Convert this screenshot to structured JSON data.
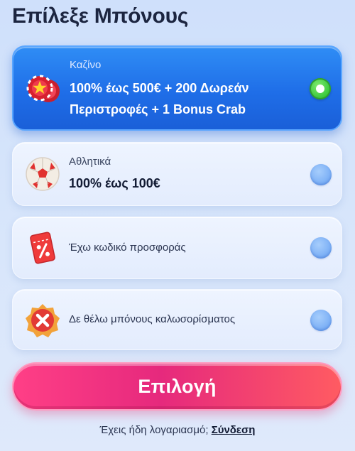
{
  "title": "Επίλεξε Μπόνους",
  "options": [
    {
      "category": "Καζίνο",
      "offer_line1": "100% έως 500€ + 200 Δωρεάν",
      "offer_line2": "Περιστροφές + 1 Bonus Crab",
      "selected": true,
      "icon": "casino-chips-icon"
    },
    {
      "category": "Αθλητικά",
      "offer_line1": "100% έως 100€",
      "selected": false,
      "icon": "soccer-ball-icon"
    },
    {
      "label": "Έχω κωδικό προσφοράς",
      "selected": false,
      "icon": "promo-ticket-icon"
    },
    {
      "label": "Δε θέλω μπόνους καλωσορίσματος",
      "selected": false,
      "icon": "no-bonus-icon"
    }
  ],
  "cta": {
    "label": "Επιλογή"
  },
  "footer": {
    "text": "Έχεις ήδη λογαριασμό;",
    "link": "Σύνδεση"
  },
  "colors": {
    "selected_card": "#1f6ee8",
    "cta": "#e6297d",
    "radio_on": "#36c63a",
    "radio_off": "#7fb2f6"
  }
}
